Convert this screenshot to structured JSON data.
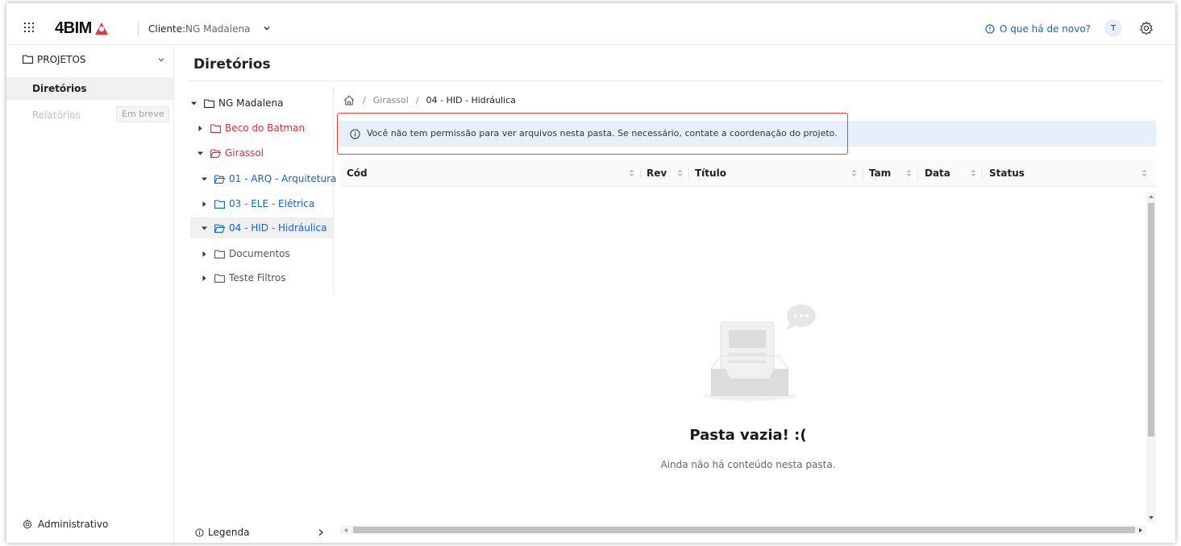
{
  "header": {
    "logo_text": "4BIM",
    "client_label": "Cliente:",
    "client_value": "NG Madalena",
    "news_link": "O que há de novo?",
    "avatar_initial": "T"
  },
  "sidebar": {
    "projects_label": "PROJETOS",
    "items": [
      {
        "label": "Diretórios",
        "active": true
      },
      {
        "label": "Relatórios",
        "disabled": true,
        "badge": "Em breve"
      }
    ],
    "admin_label": "Administrativo"
  },
  "main": {
    "title": "Diretórios"
  },
  "tree": {
    "nodes": [
      {
        "label": "NG Madalena",
        "expanded": true,
        "color": "#262626"
      },
      {
        "label": "Beco do Batman",
        "expanded": false,
        "color": "#d4313a"
      },
      {
        "label": "Girassol",
        "expanded": true,
        "color": "#d4313a"
      },
      {
        "label": "01 - ARQ - Arquitetura",
        "expanded": true,
        "color": "#1565c0"
      },
      {
        "label": "03 - ELE - Elétrica",
        "expanded": false,
        "color": "#1565c0"
      },
      {
        "label": "04 - HID - Hidráulica",
        "expanded": true,
        "selected": true,
        "color": "#1565c0"
      },
      {
        "label": "Documentos",
        "expanded": false,
        "color": "#555555"
      },
      {
        "label": "Teste Filtros",
        "expanded": false,
        "color": "#555555"
      }
    ],
    "legend_label": "Legenda"
  },
  "breadcrumb": {
    "separator": "/",
    "items": [
      "Girassol",
      "04 - HID - Hidráulica"
    ]
  },
  "alert": {
    "text": "Você não tem permissão para ver arquivos nesta pasta. Se necessário, contate a coordenação do projeto."
  },
  "table": {
    "columns": [
      "Cód",
      "Rev",
      "Título",
      "Tam",
      "Data",
      "Status"
    ]
  },
  "empty": {
    "title": "Pasta vazia! :(",
    "subtitle": "Ainda não há conteúdo nesta pasta."
  },
  "colors": {
    "accent": "#1565c0",
    "brand_red": "#e8344a",
    "alert_border": "#e04747",
    "alert_bg": "#e6f0fb"
  }
}
